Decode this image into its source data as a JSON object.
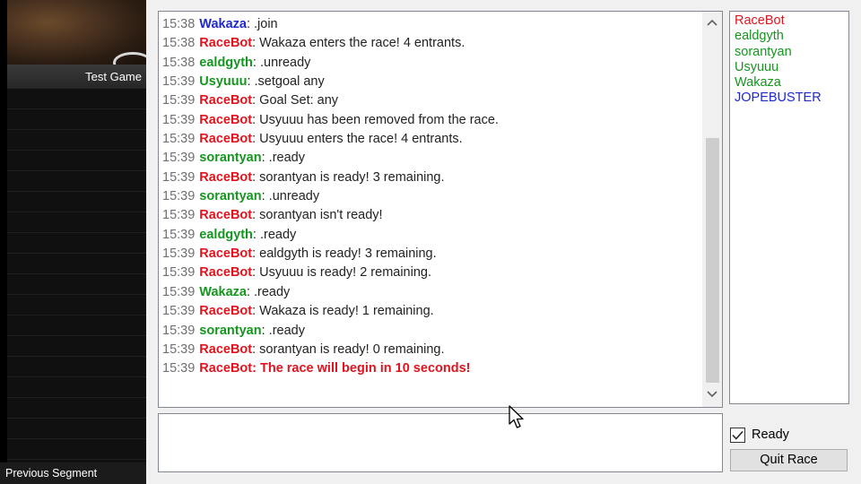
{
  "splits": {
    "game_title": "Test Game",
    "previous_segment_label": "Previous Segment",
    "segment_row_count": 19
  },
  "chat": {
    "colors": {
      "bot": "#e0141e",
      "green_user": "#15961e",
      "blue_user": "#1e28d2",
      "timestamp": "#707070"
    },
    "messages": [
      {
        "time": "15:38",
        "nick": "Wakaza",
        "nick_color": "#1e28d2",
        "text": ": .join",
        "alert": false
      },
      {
        "time": "15:38",
        "nick": "RaceBot",
        "nick_color": "#e0141e",
        "text": ": Wakaza enters the race! 4 entrants.",
        "alert": false
      },
      {
        "time": "15:38",
        "nick": "ealdgyth",
        "nick_color": "#15961e",
        "text": ": .unready",
        "alert": false
      },
      {
        "time": "15:39",
        "nick": "Usyuuu",
        "nick_color": "#15961e",
        "text": ": .setgoal any",
        "alert": false
      },
      {
        "time": "15:39",
        "nick": "RaceBot",
        "nick_color": "#e0141e",
        "text": ": Goal Set: any",
        "alert": false
      },
      {
        "time": "15:39",
        "nick": "RaceBot",
        "nick_color": "#e0141e",
        "text": ": Usyuuu has been removed from the race.",
        "alert": false
      },
      {
        "time": "15:39",
        "nick": "RaceBot",
        "nick_color": "#e0141e",
        "text": ": Usyuuu enters the race! 4 entrants.",
        "alert": false
      },
      {
        "time": "15:39",
        "nick": "sorantyan",
        "nick_color": "#15961e",
        "text": ": .ready",
        "alert": false
      },
      {
        "time": "15:39",
        "nick": "RaceBot",
        "nick_color": "#e0141e",
        "text": ": sorantyan is ready! 3 remaining.",
        "alert": false
      },
      {
        "time": "15:39",
        "nick": "sorantyan",
        "nick_color": "#15961e",
        "text": ": .unready",
        "alert": false
      },
      {
        "time": "15:39",
        "nick": "RaceBot",
        "nick_color": "#e0141e",
        "text": ": sorantyan isn't ready!",
        "alert": false
      },
      {
        "time": "15:39",
        "nick": "ealdgyth",
        "nick_color": "#15961e",
        "text": ": .ready",
        "alert": false
      },
      {
        "time": "15:39",
        "nick": "RaceBot",
        "nick_color": "#e0141e",
        "text": ": ealdgyth is ready! 3 remaining.",
        "alert": false
      },
      {
        "time": "15:39",
        "nick": "RaceBot",
        "nick_color": "#e0141e",
        "text": ": Usyuuu is ready! 2 remaining.",
        "alert": false
      },
      {
        "time": "15:39",
        "nick": "Wakaza",
        "nick_color": "#15961e",
        "text": ": .ready",
        "alert": false
      },
      {
        "time": "15:39",
        "nick": "RaceBot",
        "nick_color": "#e0141e",
        "text": ": Wakaza is ready! 1 remaining.",
        "alert": false
      },
      {
        "time": "15:39",
        "nick": "sorantyan",
        "nick_color": "#15961e",
        "text": ": .ready",
        "alert": false
      },
      {
        "time": "15:39",
        "nick": "RaceBot",
        "nick_color": "#e0141e",
        "text": ": sorantyan is ready! 0 remaining.",
        "alert": false
      },
      {
        "time": "15:39",
        "nick": "RaceBot",
        "nick_color": "#e0141e",
        "text": ": The race will begin in 10 seconds!",
        "alert": true
      }
    ],
    "input_value": ""
  },
  "users": [
    {
      "name": "RaceBot",
      "color": "#e0141e"
    },
    {
      "name": "ealdgyth",
      "color": "#15961e"
    },
    {
      "name": "sorantyan",
      "color": "#15961e"
    },
    {
      "name": "Usyuuu",
      "color": "#15961e"
    },
    {
      "name": "Wakaza",
      "color": "#15961e"
    },
    {
      "name": "JOPEBUSTER",
      "color": "#1e28d2"
    }
  ],
  "controls": {
    "ready_label": "Ready",
    "ready_checked": true,
    "quit_label": "Quit Race"
  },
  "icons": {
    "scroll_up": "chevron-up-icon",
    "scroll_down": "chevron-down-icon",
    "checkmark": "checkmark-icon",
    "cursor": "mouse-pointer-icon"
  }
}
